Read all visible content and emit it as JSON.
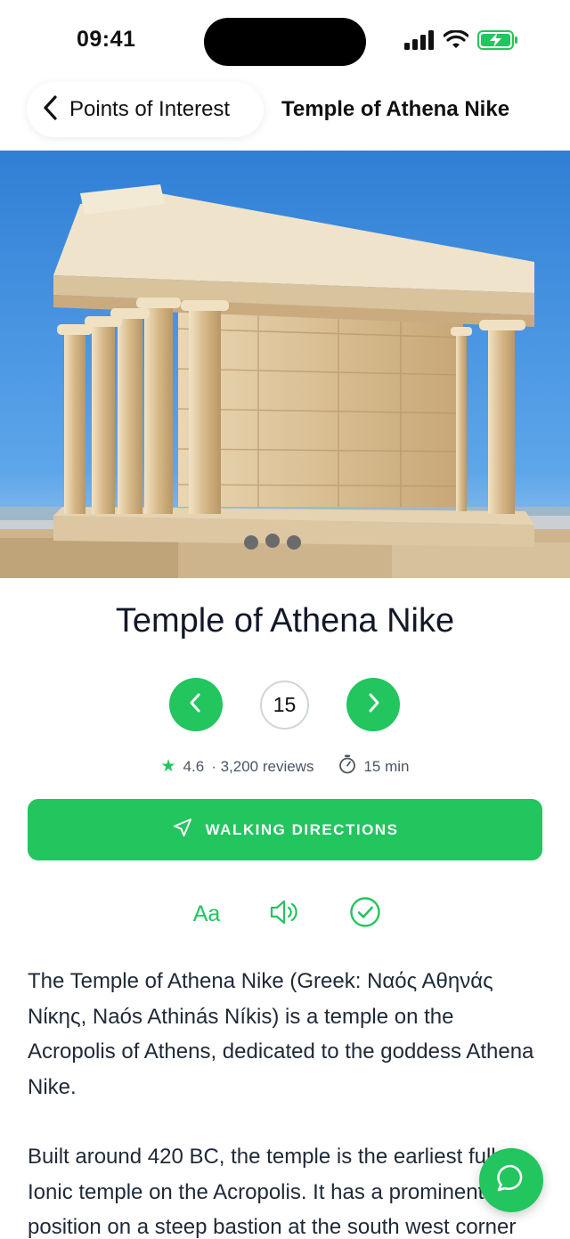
{
  "status": {
    "time": "09:41"
  },
  "nav": {
    "back_label": "Points of Interest",
    "title": "Temple of Athena Nike"
  },
  "poi": {
    "title": "Temple of Athena Nike",
    "page_number": "15",
    "rating": "4.6",
    "reviews": "· 3,200 reviews",
    "duration": "15 min"
  },
  "actions": {
    "walking_directions": "WALKING DIRECTIONS",
    "text_size_label": "Aa"
  },
  "article": {
    "paragraphs": [
      "The Temple of Athena Nike (Greek: Ναός Αθηνάς Νίκης, Naós Athinás Níkis) is a temple on the Acropolis of Athens, dedicated to the goddess Athena Nike.",
      "Built around 420 BC, the temple is the earliest fully Ionic temple on the Acropolis. It has a prominent position on a steep bastion at the south west corner"
    ]
  },
  "icons": {
    "back": "chevron-left-icon",
    "prev": "chevron-left-icon",
    "next": "chevron-right-icon",
    "star": "star-icon",
    "timer": "stopwatch-icon",
    "navigate": "navigation-arrow-icon",
    "speaker": "speaker-icon",
    "check": "check-circle-icon",
    "chat": "chat-bubble-icon"
  },
  "colors": {
    "accent": "#22c55e",
    "text": "#1f2937",
    "sky": "#3b8ee0"
  }
}
